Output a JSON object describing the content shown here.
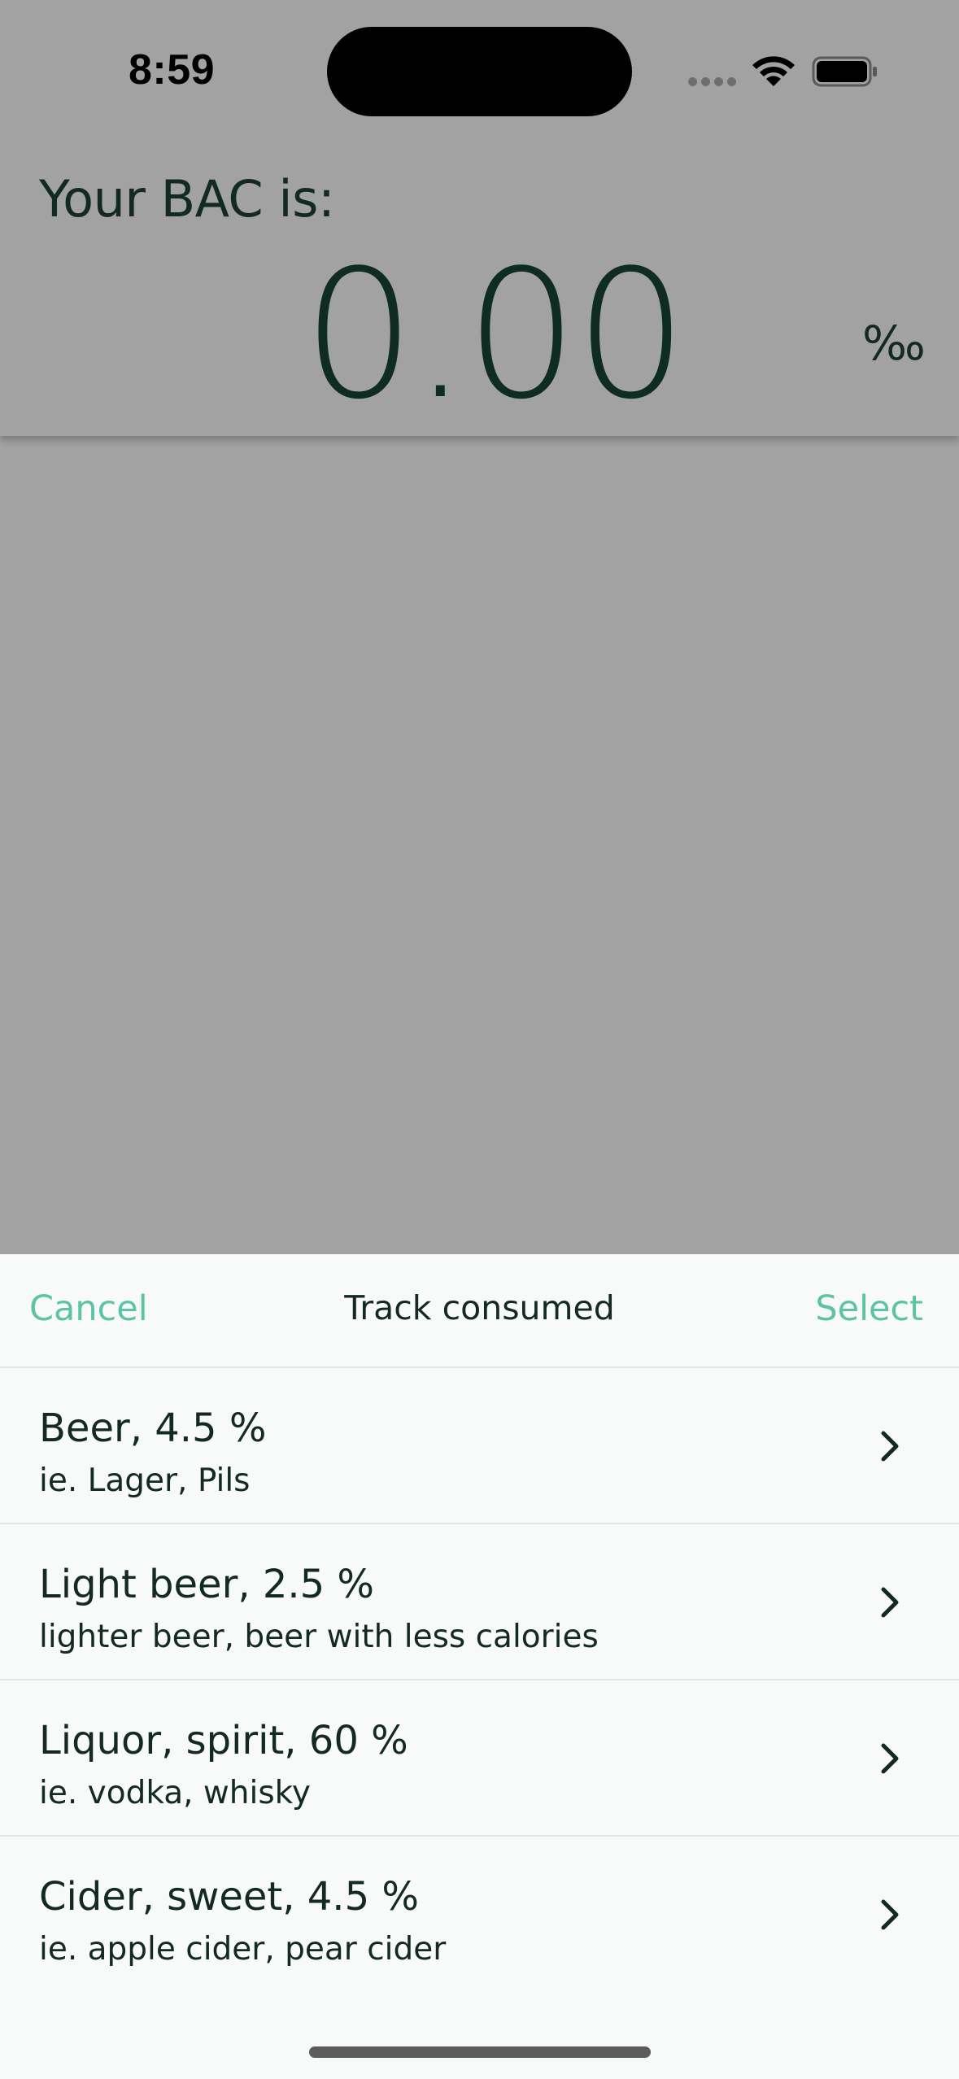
{
  "status_bar": {
    "time": "8:59",
    "wifi_icon": "wifi-icon",
    "battery_icon": "battery-icon",
    "signal_icon": "cellular-signal-icon"
  },
  "header": {
    "bac_label": "Your BAC is:",
    "bac_value": "0.00",
    "bac_unit": "‰"
  },
  "sheet": {
    "cancel_label": "Cancel",
    "title": "Track consumed",
    "select_label": "Select",
    "items": [
      {
        "name": "Beer, 4.5 %",
        "description": "ie. Lager, Pils"
      },
      {
        "name": "Light beer, 2.5 %",
        "description": "lighter beer, beer with less calories"
      },
      {
        "name": "Liquor, spirit, 60 %",
        "description": "ie. vodka, whisky"
      },
      {
        "name": "Cider, sweet, 4.5 %",
        "description": "ie. apple cider, pear cider"
      }
    ]
  },
  "colors": {
    "accent": "#5cc3a4",
    "text_dark": "#132a22",
    "overlay": "#a2a2a2",
    "sheet_bg": "#f8f9f9"
  }
}
